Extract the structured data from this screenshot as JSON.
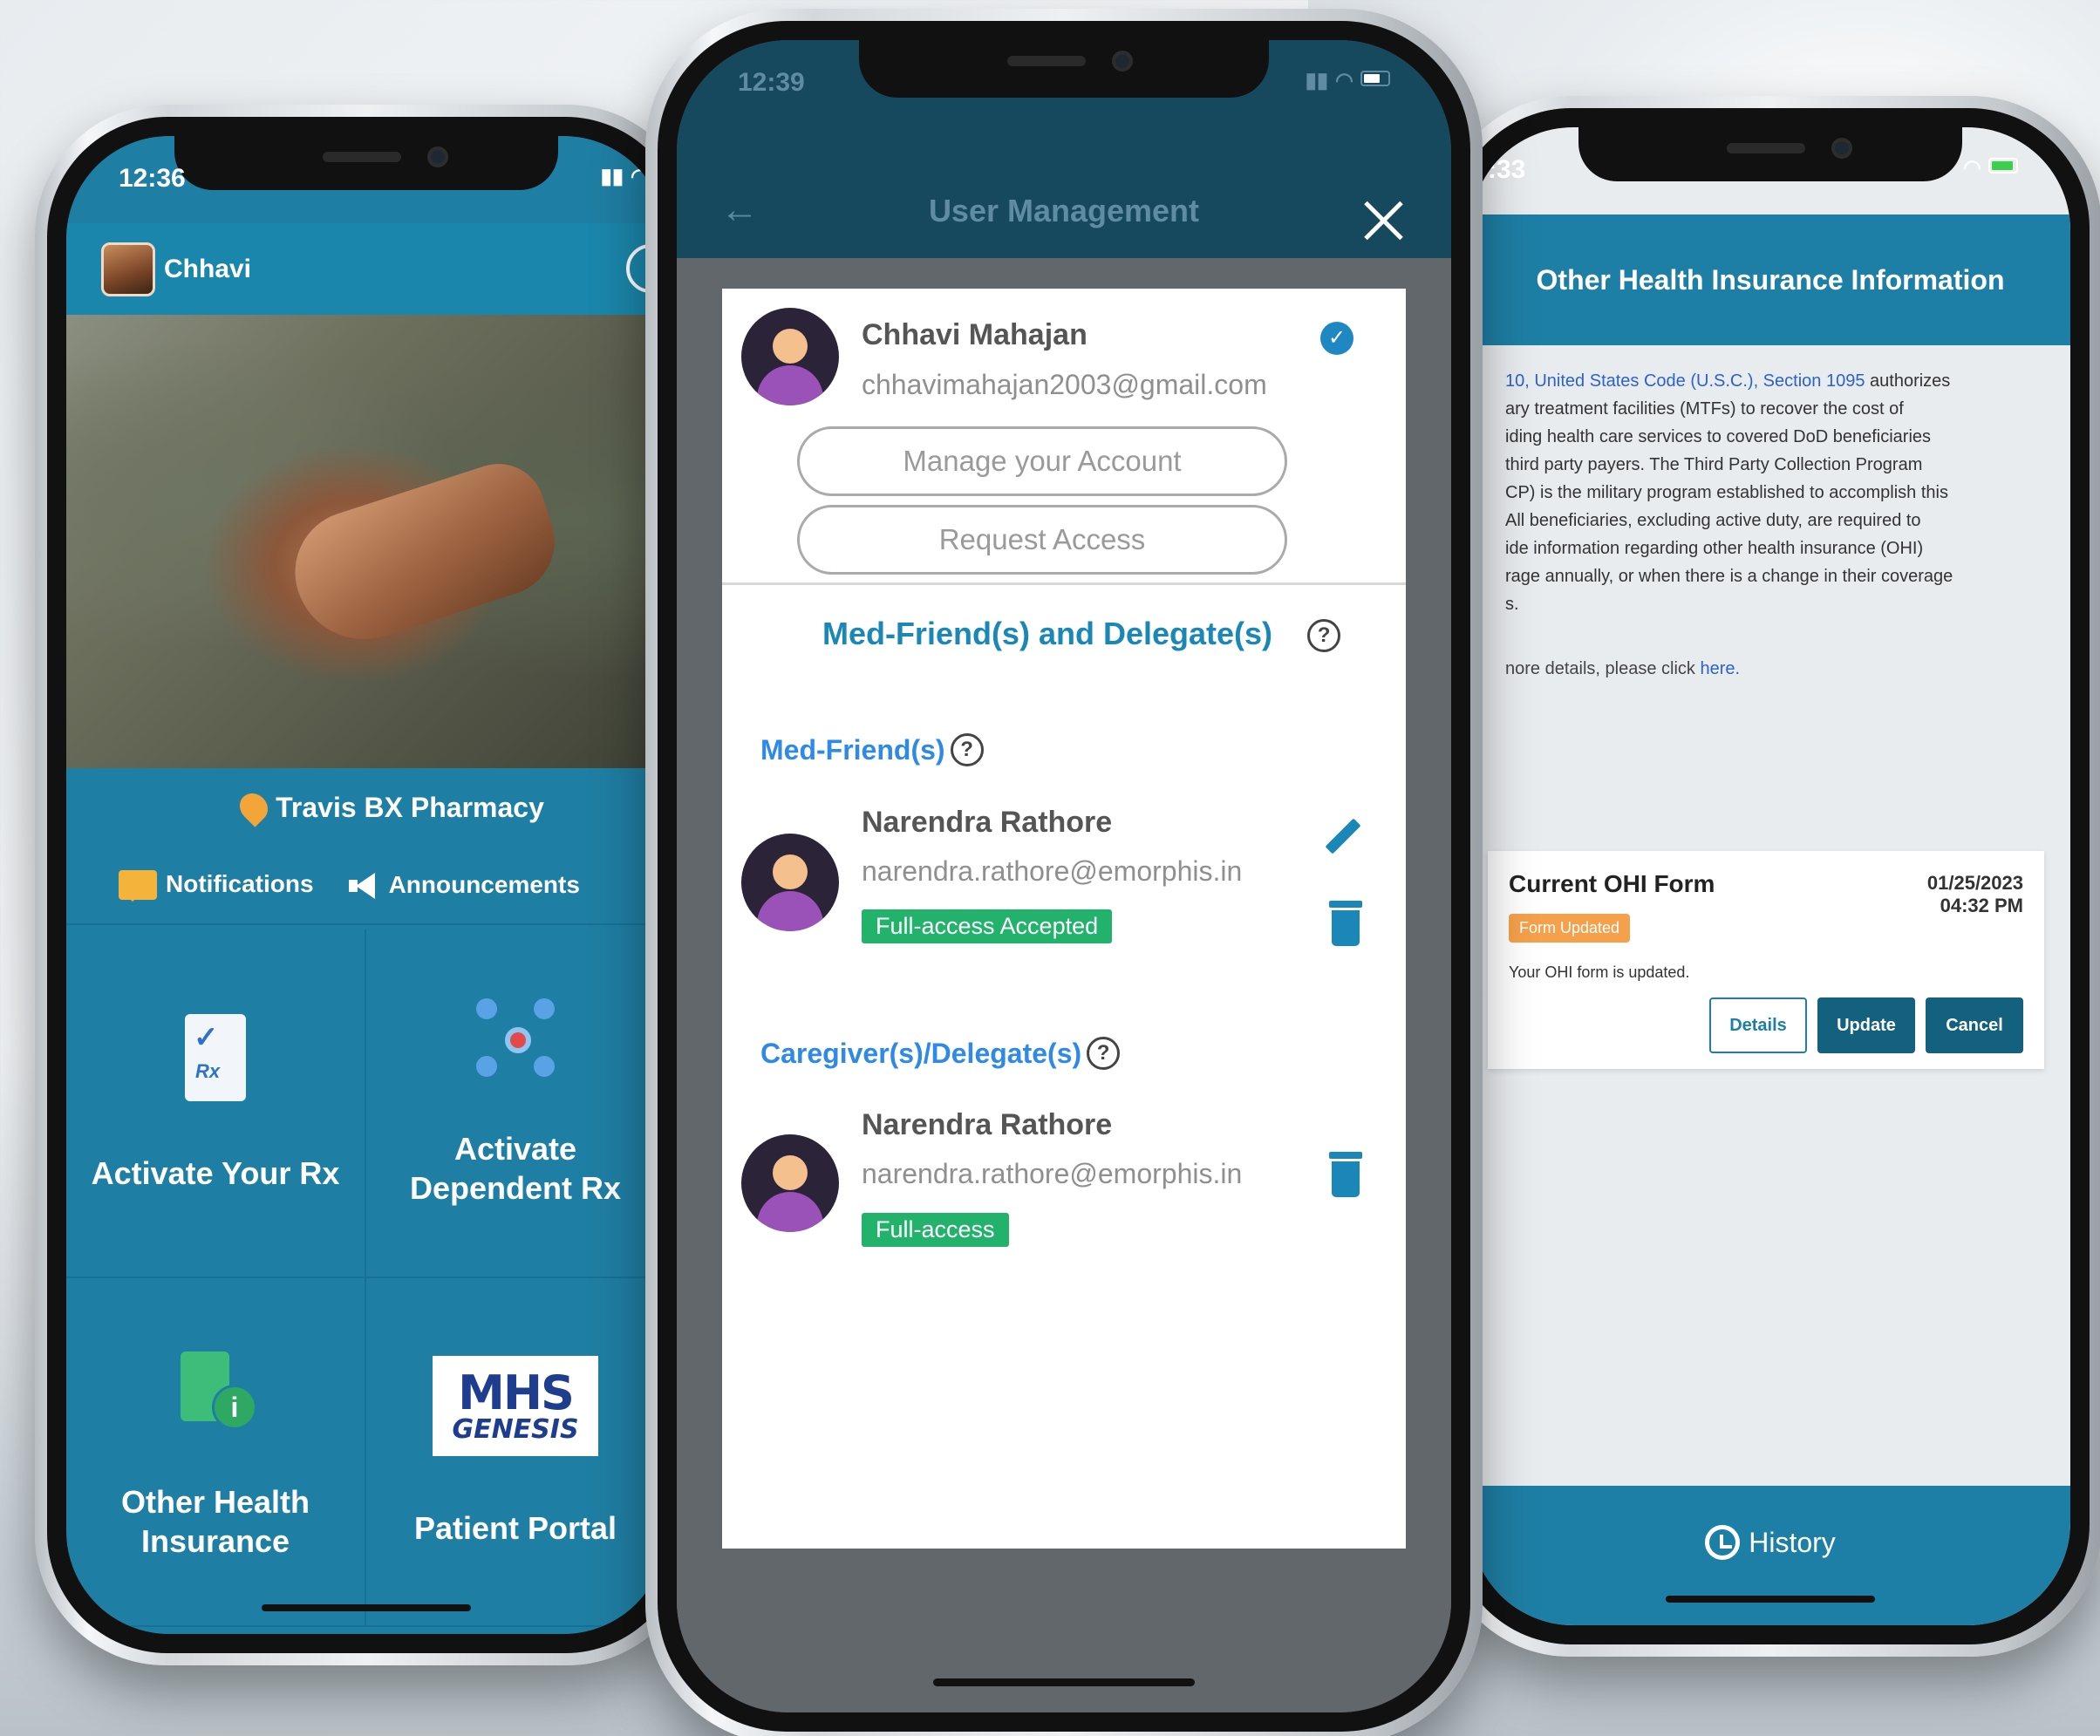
{
  "left_phone": {
    "time": "12:36",
    "profile_name": "Chhavi",
    "pharmacy": "Travis BX Pharmacy",
    "tabs": [
      "Notifications",
      "Announcements"
    ],
    "tiles": [
      {
        "label": "Activate Your Rx",
        "icon": "rx-document-icon"
      },
      {
        "label_line1": "Activate",
        "label_line2": "Dependent Rx",
        "icon": "dependent-network-icon"
      },
      {
        "label_line1": "Other Health",
        "label_line2": "Insurance",
        "icon": "insurance-clipboard-icon"
      },
      {
        "label": "Patient Portal",
        "icon": "mhs-genesis-logo",
        "logo_line1": "MHS",
        "logo_line2": "GENESIS"
      }
    ]
  },
  "center_phone": {
    "time": "12:39",
    "title": "User Management",
    "account": {
      "name": "Chhavi Mahajan",
      "email": "chhavimahajan2003@gmail.com",
      "manage_button": "Manage your Account",
      "request_button": "Request Access"
    },
    "section_title": "Med-Friend(s) and Delegate(s)",
    "med_friends_label": "Med-Friend(s)",
    "med_friend": {
      "name": "Narendra Rathore",
      "email": "narendra.rathore@emorphis.in",
      "status": "Full-access Accepted"
    },
    "caregivers_label": "Caregiver(s)/Delegate(s)",
    "caregiver": {
      "name": "Narendra Rathore",
      "email": "narendra.rathore@emorphis.in",
      "status": "Full-access"
    }
  },
  "right_phone": {
    "time": ":33",
    "title": "Other Health Insurance Information",
    "body_link": "10, United States Code (U.S.C.), Section 1095",
    "body_lines": [
      "authorizes",
      "ary treatment facilities (MTFs) to recover the cost of",
      "iding health care services to covered DoD beneficiaries",
      "third party payers. The Third Party Collection Program",
      "CP) is the military program established to accomplish this",
      "All beneficiaries, excluding active duty, are required to",
      "ide information regarding other health insurance (OHI)",
      "rage annually, or when there is a change in their coverage",
      "s."
    ],
    "more_text": "nore details, please click",
    "more_link": "here.",
    "card": {
      "title": "Current OHI Form",
      "date": "01/25/2023",
      "time": "04:32 PM",
      "badge": "Form Updated",
      "note": "Your OHI form is updated.",
      "buttons": [
        "Details",
        "Update",
        "Cancel"
      ]
    },
    "footer": "History"
  },
  "colors": {
    "app_blue": "#1f7ea3",
    "dark_header": "#16485e",
    "accent_link": "#1a87b8",
    "status_green": "#23b26b",
    "status_orange": "#f5a04a"
  }
}
